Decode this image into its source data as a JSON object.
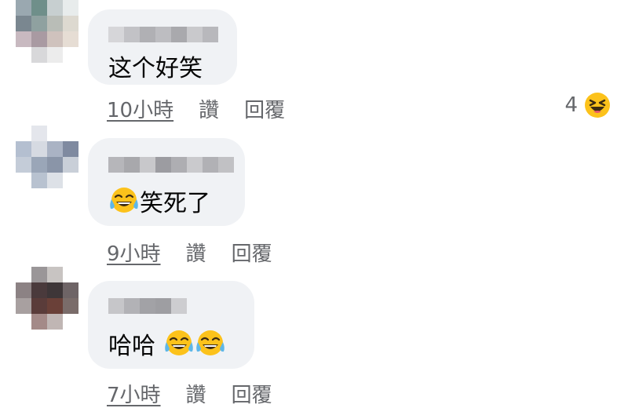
{
  "comments": [
    {
      "text": "这个好笑",
      "time": "10小時",
      "like": "讚",
      "reply": "回覆",
      "reaction_count": "4",
      "reaction_icon": "laughing-squint-emoji"
    },
    {
      "text": "笑死了",
      "emoji": "tears-of-joy-emoji",
      "time": "9小時",
      "like": "讚",
      "reply": "回覆"
    },
    {
      "text": "哈哈",
      "emoji": "tears-of-joy-emoji",
      "time": "7小時",
      "like": "讚",
      "reply": "回覆"
    }
  ],
  "colors": {
    "bubble": "#f0f2f5",
    "meta_text": "#65676b",
    "comment_text": "#050505",
    "emoji_yellow": "#fcc21b"
  }
}
